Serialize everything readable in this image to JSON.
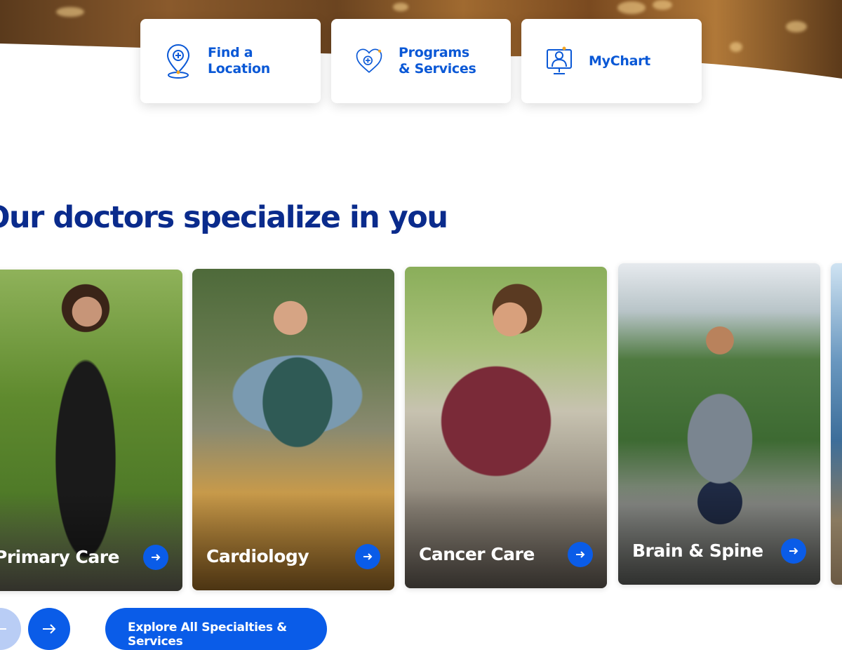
{
  "quick_links": [
    {
      "label": "Find a Location",
      "icon": "location-pin-icon"
    },
    {
      "label": "Programs & Services",
      "icon": "heart-plus-icon"
    },
    {
      "label": "MyChart",
      "icon": "doctor-monitor-icon"
    }
  ],
  "section_title": "Our doctors specialize in you",
  "specialties": [
    {
      "label": "Primary Care",
      "icon": "arrow-right-icon"
    },
    {
      "label": "Cardiology",
      "icon": "arrow-right-icon"
    },
    {
      "label": "Cancer Care",
      "icon": "arrow-right-icon"
    },
    {
      "label": "Brain & Spine",
      "icon": "arrow-right-icon"
    }
  ],
  "explore_button": "Explore All Specialties & Services",
  "colors": {
    "accent": "#0a5ce8",
    "heading": "#0a2b8c",
    "link": "#0a58d6",
    "icon_dot": "#f5a623"
  }
}
